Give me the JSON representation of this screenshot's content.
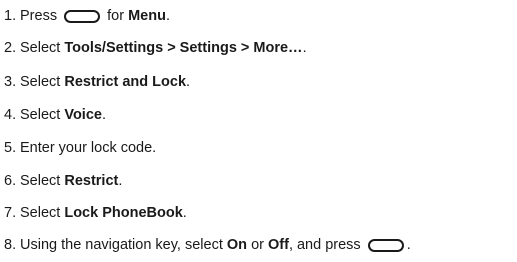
{
  "steps": [
    {
      "number": "1.",
      "pre": "Press",
      "key_name": "menu-ok-key-icon",
      "mid": "for",
      "bold": "Menu",
      "post": "."
    },
    {
      "number": "2.",
      "pre": "Select",
      "bold": "Tools/Settings > Settings > More…",
      "post": "."
    },
    {
      "number": "3.",
      "pre": "Select",
      "bold": "Restrict and Lock",
      "post": "."
    },
    {
      "number": "4.",
      "pre": "Select",
      "bold": "Voice",
      "post": "."
    },
    {
      "number": "5.",
      "text": "Enter your lock code."
    },
    {
      "number": "6.",
      "pre": "Select",
      "bold": "Restrict",
      "post": "."
    },
    {
      "number": "7.",
      "pre": "Select",
      "bold": "Lock PhoneBook",
      "post": "."
    },
    {
      "number": "8.",
      "pre": "Using the navigation key, select",
      "bold": "On",
      "mid": "or",
      "bold2": "Off",
      "post": ", and press",
      "key_name": "menu-ok-key-icon",
      "end": "."
    }
  ]
}
